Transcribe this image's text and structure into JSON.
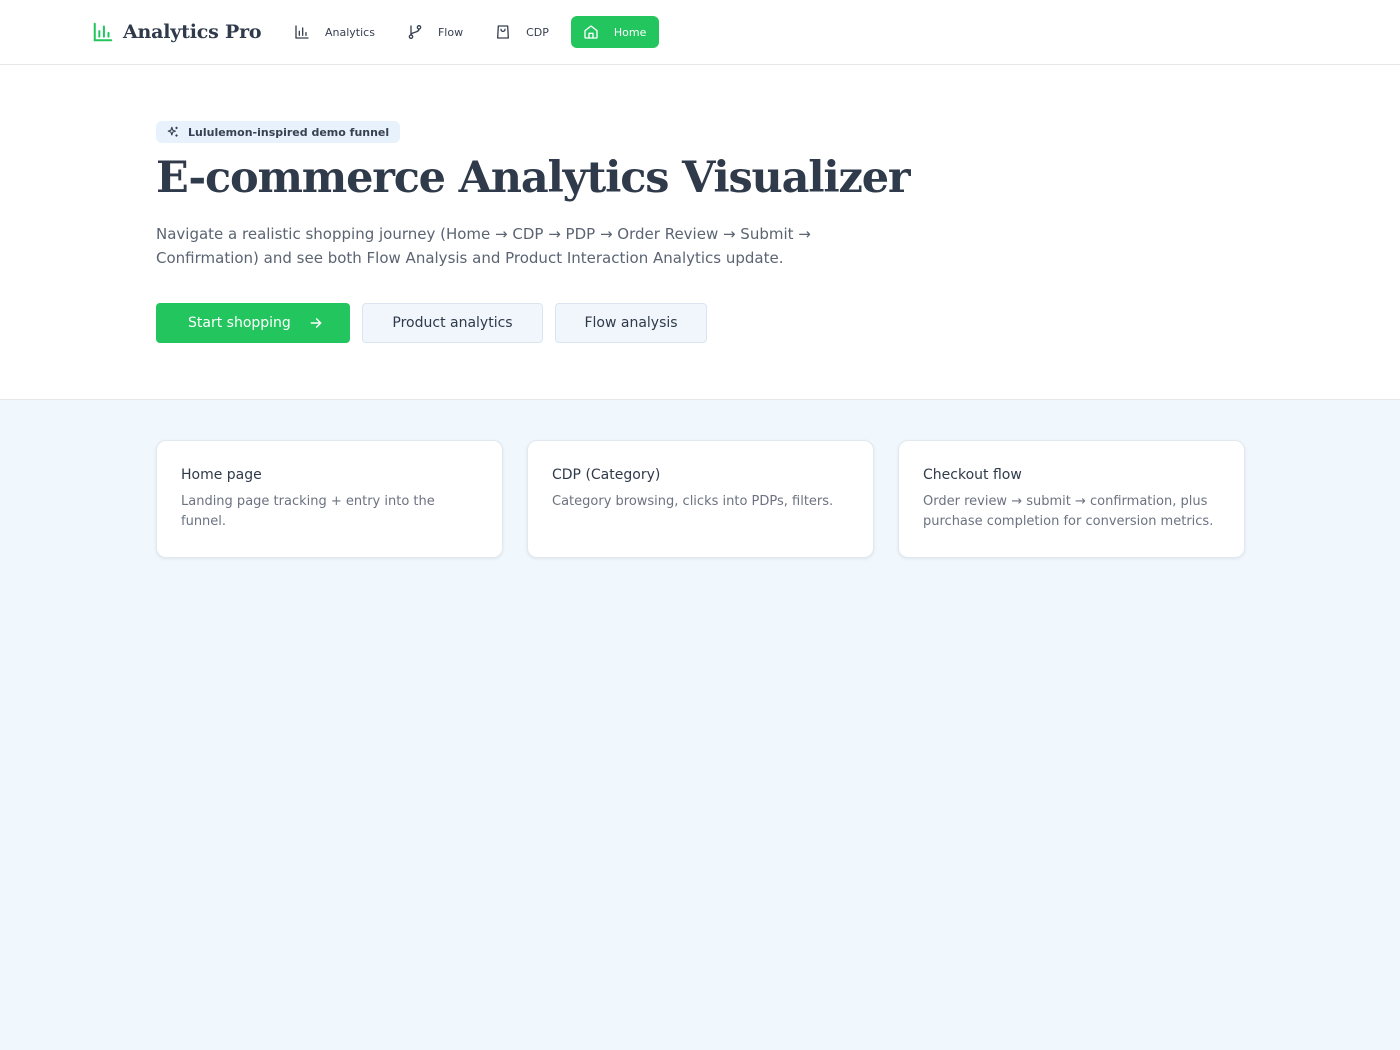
{
  "app": {
    "name": "Analytics Pro",
    "brand_color": "#22c55e"
  },
  "nav": {
    "items": [
      {
        "label": "Analytics",
        "icon": "bar-chart-icon",
        "active": false
      },
      {
        "label": "Flow",
        "icon": "git-branch-icon",
        "active": false
      },
      {
        "label": "CDP",
        "icon": "shopping-bag-icon",
        "active": false
      },
      {
        "label": "Home",
        "icon": "home-icon",
        "active": true
      }
    ]
  },
  "hero": {
    "tag": {
      "label": "Lululemon-inspired demo funnel",
      "icon": "sparkles-icon"
    },
    "title": "E-commerce Analytics Visualizer",
    "description": "Navigate a realistic shopping journey (Home → CDP → PDP → Order Review → Submit → Confirmation) and see both Flow Analysis and Product Interaction Analytics update.",
    "buttons": {
      "start_shopping": {
        "label": "Start shopping",
        "icon": "arrow-right-icon"
      },
      "product_analytics": {
        "label": "Product analytics"
      },
      "flow_analysis": {
        "label": "Flow analysis"
      }
    }
  },
  "cards": [
    {
      "title": "Home page",
      "description": "Landing page tracking + entry into the funnel."
    },
    {
      "title": "CDP (Category)",
      "description": "Category browsing, clicks into PDPs, filters."
    },
    {
      "title": "Checkout flow",
      "description": "Order review → submit → confirmation, plus purchase completion for conversion metrics."
    }
  ]
}
